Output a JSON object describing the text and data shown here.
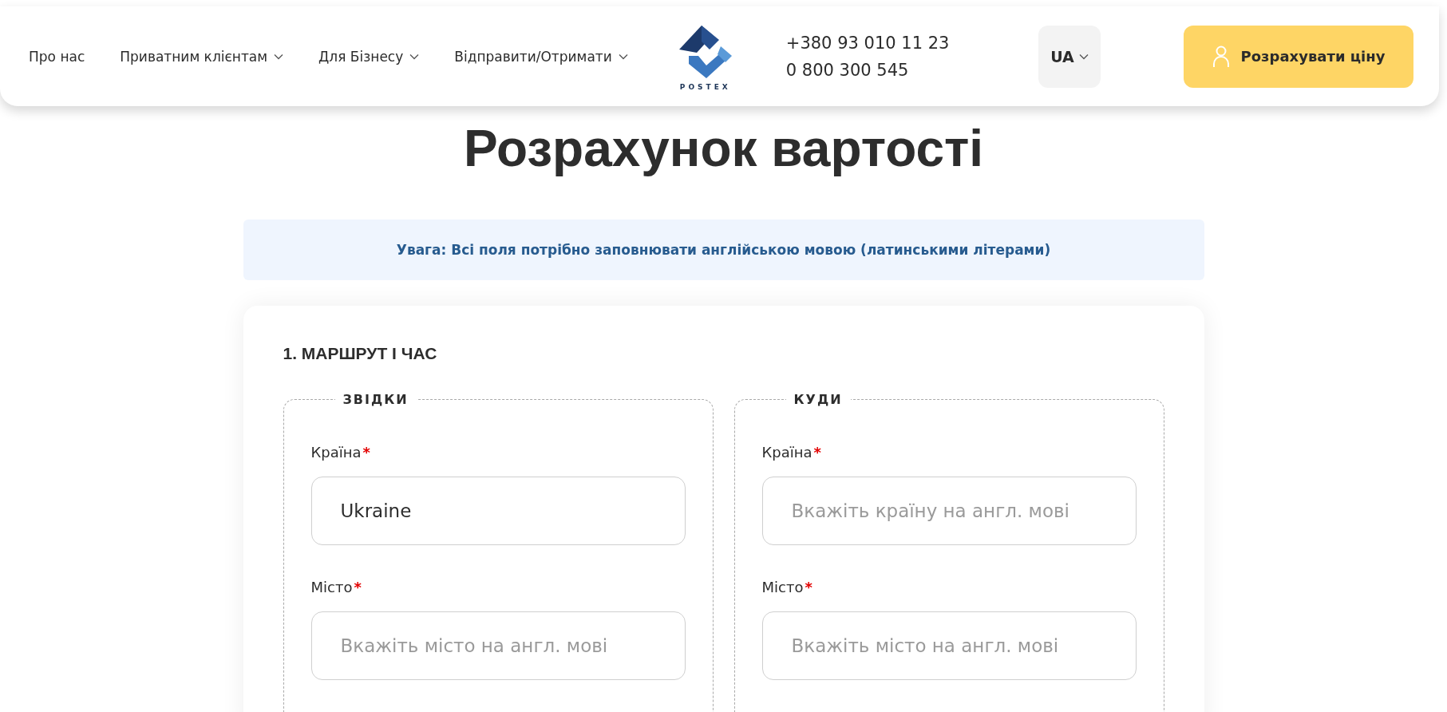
{
  "header": {
    "nav": [
      {
        "label": "Про нас",
        "dropdown": false
      },
      {
        "label": "Приватним клієнтам",
        "dropdown": true
      },
      {
        "label": "Для Бізнесу",
        "dropdown": true
      },
      {
        "label": "Відправити/Отримати",
        "dropdown": true
      }
    ],
    "logo": {
      "text": "POSTEX"
    },
    "phones": [
      "+380 93 010 11 23",
      "0 800 300 545"
    ],
    "language": "UA",
    "cta": "Розрахувати ціну"
  },
  "title": "Розрахунок вартості",
  "notice": "Увага: Всі поля потрібно заповнювати англійською мовою (латинськими літерами)",
  "section": {
    "heading": "1. МАРШРУТ І ЧАС",
    "groups": [
      {
        "legend": "ЗВІДКИ",
        "fields": [
          {
            "label": "Країна",
            "mark": "*",
            "value": "Ukraine"
          },
          {
            "label": "Місто",
            "mark": "*",
            "placeholder": "Вкажіть місто на англ. мові"
          }
        ]
      },
      {
        "legend": "КУДИ",
        "fields": [
          {
            "label": "Країна",
            "mark": "*",
            "placeholder": "Вкажіть країну на англ. мові"
          },
          {
            "label": "Місто",
            "mark": "*",
            "placeholder": "Вкажіть місто на англ. мові"
          }
        ]
      }
    ]
  }
}
